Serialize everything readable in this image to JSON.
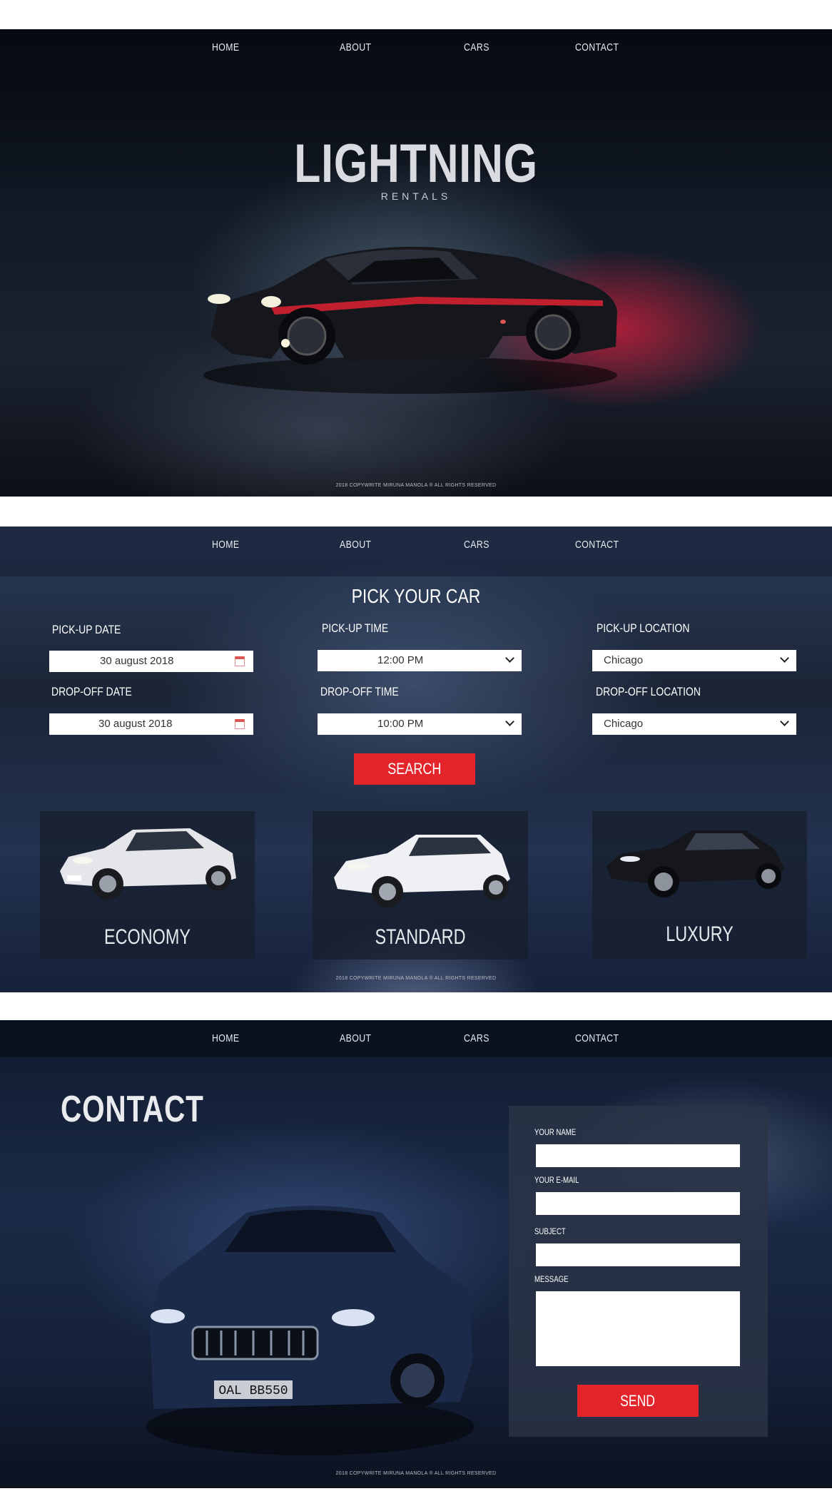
{
  "nav": {
    "home": "HOME",
    "about": "ABOUT",
    "cars": "CARS",
    "contact": "CONTACT"
  },
  "copyright": "2018 COPYWRITE MIRUNA MANOLA ® ALL RIGHTS RESERVED",
  "hero": {
    "brand": "LIGHTNING",
    "tagline": "RENTALS"
  },
  "picker": {
    "title": "PICK YOUR CAR",
    "pickup_date_label": "PICK-UP DATE",
    "pickup_date_value": "30  august  2018",
    "dropoff_date_label": "DROP-OFF DATE",
    "dropoff_date_value": "30  august  2018",
    "pickup_time_label": "PICK-UP TIME",
    "pickup_time_value": "12:00  PM",
    "dropoff_time_label": "DROP-OFF TIME",
    "dropoff_time_value": "10:00  PM",
    "pickup_location_label": "PICK-UP LOCATION",
    "pickup_location_value": "Chicago",
    "dropoff_location_label": "DROP-OFF LOCATION",
    "dropoff_location_value": "Chicago",
    "search_label": "SEARCH",
    "categories": [
      "ECONOMY",
      "STANDARD",
      "LUXURY"
    ]
  },
  "contact": {
    "title": "CONTACT",
    "name_label": "YOUR NAME",
    "email_label": "YOUR E-MAIL",
    "subject_label": "SUBJECT",
    "message_label": "MESSAGE",
    "send_label": "SEND",
    "plate": "OAL BB550"
  },
  "colors": {
    "accent": "#e3242b",
    "hero_glow": "#dc1e3c",
    "panel": "#2a3446"
  }
}
